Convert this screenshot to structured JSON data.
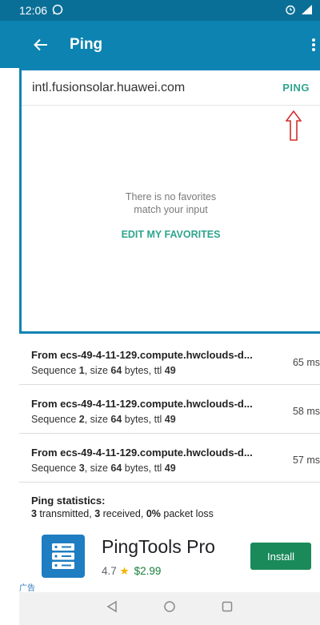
{
  "status_bar": {
    "time": "12:06"
  },
  "app_bar": {
    "title": "Ping"
  },
  "search": {
    "value": "intl.fusionsolar.huawei.com",
    "ping_label": "PING"
  },
  "favorites": {
    "empty_line1": "There is no favorites",
    "empty_line2": "match your input",
    "edit_label": "EDIT MY FAVORITES"
  },
  "results": [
    {
      "from": "From ecs-49-4-11-129.compute.hwclouds-d...",
      "seq_label": "Sequence ",
      "seq": "1",
      "size_label": ", size ",
      "size": "64",
      "bytes_label": " bytes, ttl ",
      "ttl": "49",
      "time": "65 ms"
    },
    {
      "from": "From ecs-49-4-11-129.compute.hwclouds-d...",
      "seq_label": "Sequence ",
      "seq": "2",
      "size_label": ", size ",
      "size": "64",
      "bytes_label": " bytes, ttl ",
      "ttl": "49",
      "time": "58 ms"
    },
    {
      "from": "From ecs-49-4-11-129.compute.hwclouds-d...",
      "seq_label": "Sequence ",
      "seq": "3",
      "size_label": ", size ",
      "size": "64",
      "bytes_label": " bytes, ttl ",
      "ttl": "49",
      "time": "57 ms"
    }
  ],
  "statistics": {
    "heading": "Ping statistics:",
    "transmitted": "3",
    "transmitted_label": " transmitted, ",
    "received": "3",
    "received_label": " received, ",
    "loss": "0%",
    "loss_label": " packet loss"
  },
  "ad": {
    "app_name": "PingTools Pro",
    "rating": "4.7",
    "price": "$2.99",
    "install_label": "Install",
    "ad_tag": "广告"
  },
  "colors": {
    "app_bar": "#0c83b0",
    "status_bar": "#0a6f97",
    "accent": "#2fa58e",
    "install": "#1a8a5a"
  }
}
